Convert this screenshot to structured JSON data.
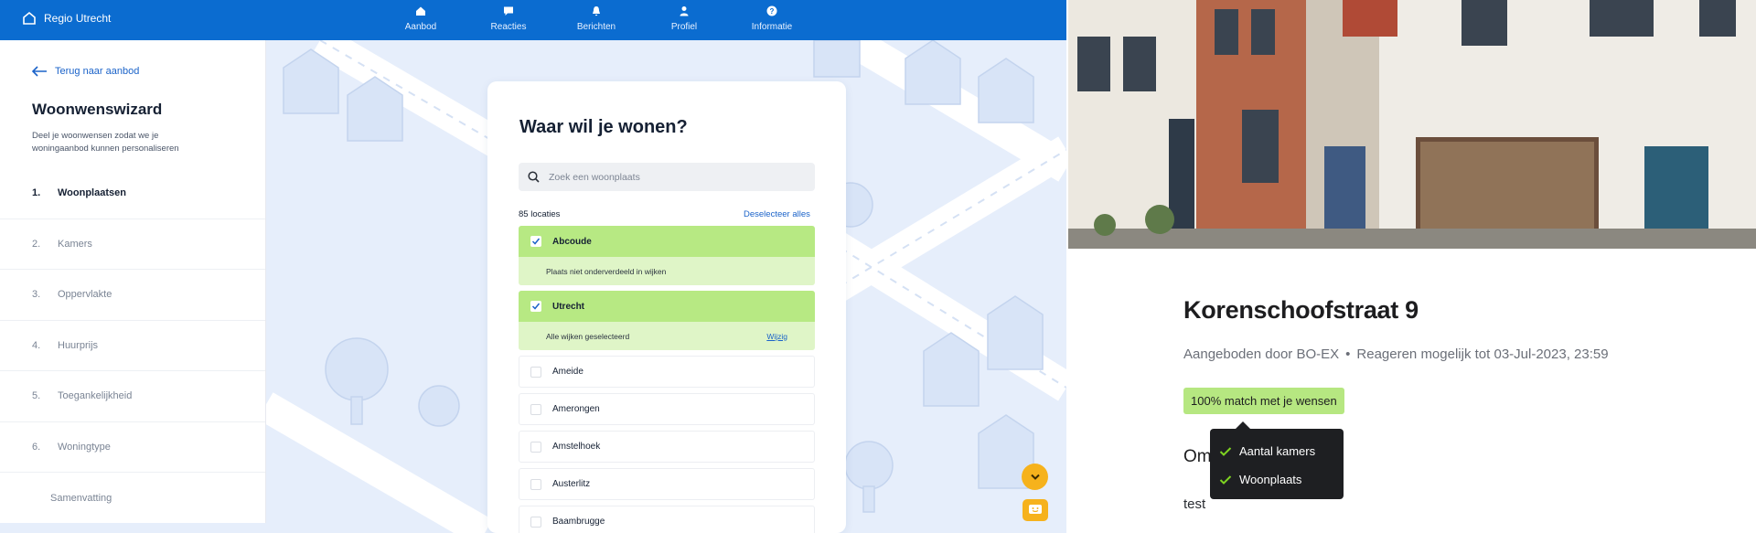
{
  "topbar": {
    "brand": "Regio Utrecht",
    "nav": [
      {
        "label": "Aanbod",
        "icon": "home-icon"
      },
      {
        "label": "Reacties",
        "icon": "chat-icon"
      },
      {
        "label": "Berichten",
        "icon": "bell-icon"
      },
      {
        "label": "Profiel",
        "icon": "user-icon"
      },
      {
        "label": "Informatie",
        "icon": "help-icon"
      }
    ]
  },
  "sidebar": {
    "back_label": "Terug naar aanbod",
    "title": "Woonwenswizard",
    "subtitle": "Deel je woonwensen zodat we je woningaanbod kunnen personaliseren",
    "steps": [
      {
        "num": "1.",
        "label": "Woonplaatsen"
      },
      {
        "num": "2.",
        "label": "Kamers"
      },
      {
        "num": "3.",
        "label": "Oppervlakte"
      },
      {
        "num": "4.",
        "label": "Huurprijs"
      },
      {
        "num": "5.",
        "label": "Toegankelijkheid"
      },
      {
        "num": "6.",
        "label": "Woningtype"
      }
    ],
    "summary": "Samenvatting"
  },
  "card": {
    "title": "Waar wil je wonen?",
    "search_placeholder": "Zoek een woonplaats",
    "count": "85 locaties",
    "deselect": "Deselecteer alles",
    "selected": [
      {
        "name": "Abcoude",
        "note": "Plaats niet onderverdeeld in wijken",
        "link": ""
      },
      {
        "name": "Utrecht",
        "note": "Alle wijken geselecteerd",
        "link": "Wijzig"
      }
    ],
    "locations": [
      "Ameide",
      "Amerongen",
      "Amstelhoek",
      "Austerlitz",
      "Baambrugge"
    ]
  },
  "listing": {
    "title": "Korenschoofstraat 9",
    "offered_by": "Aangeboden door BO-EX",
    "separator": "•",
    "deadline": "Reageren mogelijk tot 03-Jul-2023, 23:59",
    "match": "100% match met je wensen",
    "om": "Om",
    "body": "test",
    "tooltip": [
      "Aantal kamers",
      "Woonplaats"
    ]
  },
  "colors": {
    "topbar": "#0b6cd0",
    "selected_green": "#b7e983",
    "accent_yellow": "#f6b21c"
  }
}
